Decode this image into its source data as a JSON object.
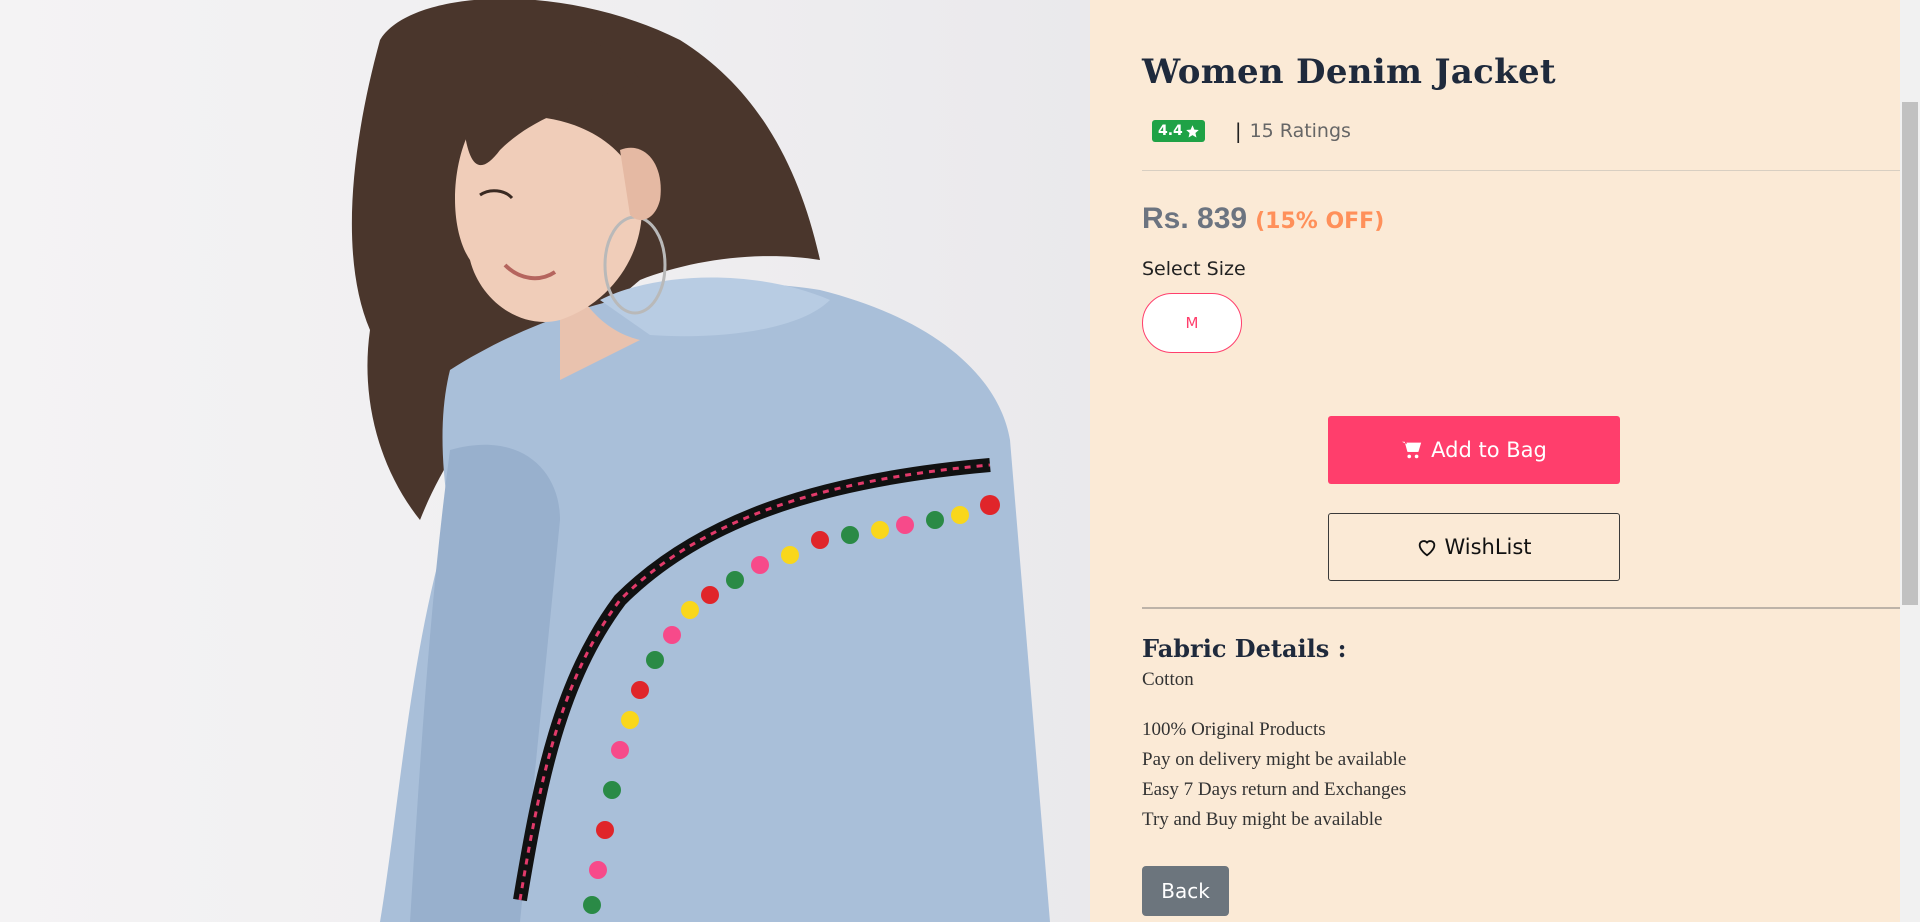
{
  "product": {
    "title": "Women Denim Jacket",
    "rating": "4.4",
    "rating_separator": "|",
    "ratings_count": "15 Ratings",
    "price": "Rs. 839",
    "discount": "(15% OFF)"
  },
  "size": {
    "label": "Select Size",
    "options": [
      "M"
    ]
  },
  "actions": {
    "add_to_bag": "Add to Bag",
    "wishlist": "WishList",
    "back": "Back"
  },
  "fabric": {
    "heading": "Fabric Details :",
    "value": "Cotton"
  },
  "features": [
    "100% Original Products",
    "Pay on delivery might be available",
    "Easy 7 Days return and Exchanges",
    "Try and Buy might be available"
  ],
  "icons": {
    "rating": "star-icon",
    "add_to_bag": "cart-icon",
    "wishlist": "heart-icon"
  },
  "colors": {
    "accent": "#ff3e6c",
    "rating_badge": "#1fa246",
    "discount": "#ff905a",
    "panel_background": "#fbead6",
    "back_button": "#6c757d"
  }
}
